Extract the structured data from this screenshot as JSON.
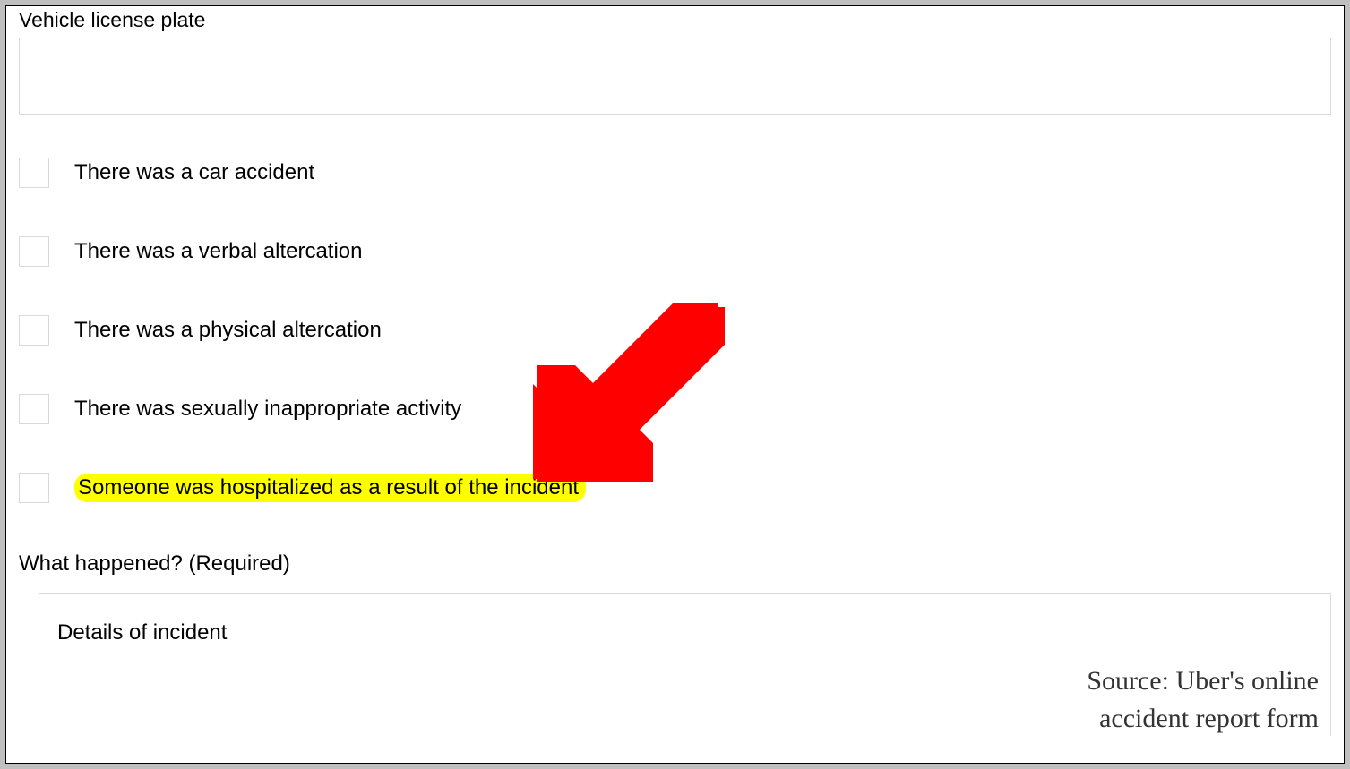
{
  "form": {
    "license_plate_label": "Vehicle license plate",
    "license_plate_value": "",
    "checkboxes": [
      {
        "id": "car-accident",
        "label": "There was a car accident",
        "highlighted": false
      },
      {
        "id": "verbal-altercation",
        "label": "There was a verbal altercation",
        "highlighted": false
      },
      {
        "id": "physical-altercation",
        "label": "There was a physical altercation",
        "highlighted": false
      },
      {
        "id": "sexually-inappropriate",
        "label": "There was sexually inappropriate activity",
        "highlighted": false
      },
      {
        "id": "hospitalized",
        "label": "Someone was hospitalized as a result of the incident",
        "highlighted": true
      }
    ],
    "what_happened_label": "What happened? (Required)",
    "details_placeholder": "Details of incident"
  },
  "annotation": {
    "arrow_color": "#ff0000",
    "highlight_color": "#ffff00",
    "source_line1": "Source: Uber's online",
    "source_line2": "accident report form"
  }
}
